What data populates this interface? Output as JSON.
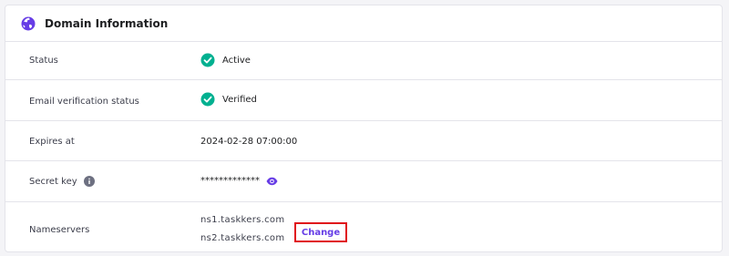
{
  "card": {
    "title": "Domain Information",
    "title_icon": "globe-icon"
  },
  "rows": {
    "status": {
      "label": "Status",
      "value": "Active",
      "icon": "check-circle-icon"
    },
    "email_verification": {
      "label": "Email verification status",
      "value": "Verified",
      "icon": "check-circle-icon"
    },
    "expires": {
      "label": "Expires at",
      "value": "2024-02-28 07:00:00"
    },
    "secret_key": {
      "label": "Secret key",
      "value": "*************",
      "info_icon": "info-icon",
      "reveal_icon": "eye-icon"
    },
    "nameservers": {
      "label": "Nameservers",
      "values": [
        "ns1.taskkers.com",
        "ns2.taskkers.com"
      ],
      "change_label": "Change"
    }
  },
  "colors": {
    "accent": "#673de6",
    "success": "#00b090",
    "highlight": "#e0101b"
  }
}
